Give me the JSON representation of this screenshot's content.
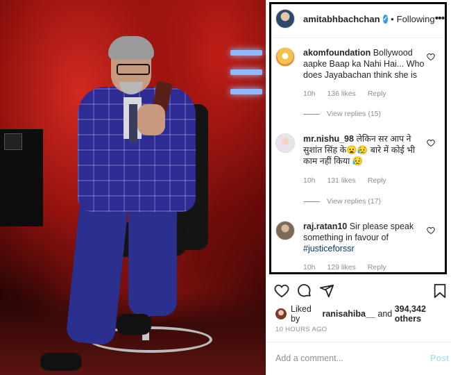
{
  "photo": {
    "description_icon": "photo"
  },
  "header": {
    "username": "amitabhbachchan",
    "verified_icon": "verified-badge-icon",
    "separator": "•",
    "follow_status": "Following",
    "more_icon": "more-options-icon",
    "more_glyph": "•••"
  },
  "comments": [
    {
      "username": "akomfoundation",
      "text": "Bollywood aapke Baap ka Nahi Hai... Who does Jayabachan think she is",
      "time": "10h",
      "likes": "136 likes",
      "reply": "Reply",
      "view_replies": "View replies (15)"
    },
    {
      "username": "mr.nishu_98",
      "text": "लेकिन सर आप ने सुशांत सिंह के😦😥 बारे में कोई भी काम नहीं किया 😥",
      "time": "10h",
      "likes": "131 likes",
      "reply": "Reply",
      "view_replies": "View replies (17)"
    },
    {
      "username": "raj.ratan10",
      "text": "Sir please speak something in favour of",
      "hashtag": "#justiceforssr",
      "time": "10h",
      "likes": "129 likes",
      "reply": "Reply"
    }
  ],
  "actions": {
    "like_icon": "heart-icon",
    "comment_icon": "comment-icon",
    "share_icon": "share-icon",
    "save_icon": "bookmark-icon"
  },
  "likes": {
    "prefix": "Liked by",
    "user": "ranisahiba__",
    "conjunction": "and",
    "count": "394,342 others"
  },
  "timestamp": "10 HOURS AGO",
  "composer": {
    "placeholder": "Add a comment...",
    "post_label": "Post"
  },
  "colors": {
    "verified": "#3897f0",
    "post_disabled": "#b2dffc",
    "hashtag": "#00376b",
    "muted": "#8e8e8e"
  }
}
